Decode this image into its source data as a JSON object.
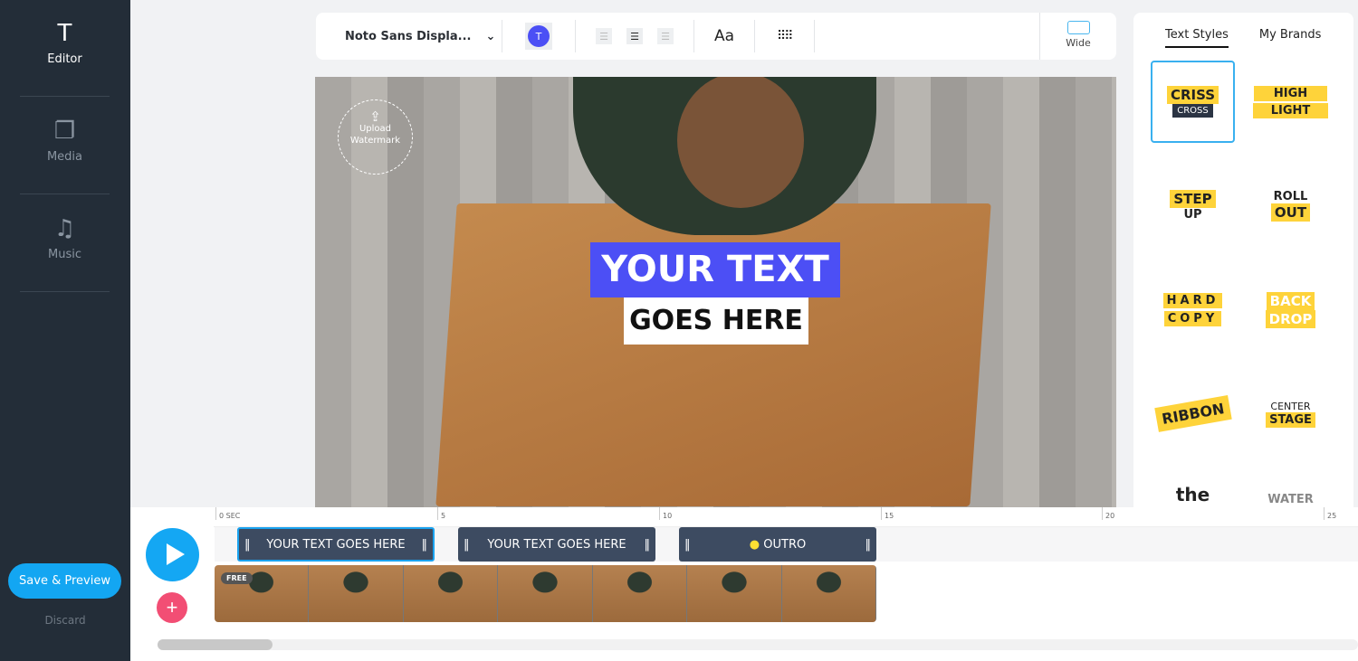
{
  "sidebar": {
    "items": [
      {
        "label": "Editor",
        "icon": "text-icon"
      },
      {
        "label": "Media",
        "icon": "media-icon"
      },
      {
        "label": "Music",
        "icon": "music-icon"
      }
    ],
    "save_label": "Save & Preview",
    "discard_label": "Discard"
  },
  "toolbar": {
    "font": "Noto Sans Displa...",
    "color_label": "T",
    "aa": "Aa",
    "aspect": "Wide",
    "accent": "#4b4ff5"
  },
  "canvas": {
    "watermark_label": "Upload Watermark",
    "text_line1": "YOUR TEXT",
    "text_line2": "GOES HERE"
  },
  "panel": {
    "tabs": [
      "Text Styles",
      "My Brands"
    ],
    "styles": [
      {
        "lines": [
          "CRISS",
          "CROSS"
        ]
      },
      {
        "lines": [
          "HIGH",
          "LIGHT"
        ]
      },
      {
        "lines": [
          "STEP",
          "UP"
        ]
      },
      {
        "lines": [
          "ROLL",
          "OUT"
        ]
      },
      {
        "lines": [
          "HARD",
          "COPY"
        ]
      },
      {
        "lines": [
          "BACK",
          "DROP"
        ]
      },
      {
        "lines": [
          "RIBBON"
        ]
      },
      {
        "lines": [
          "CENTER",
          "STAGE"
        ]
      },
      {
        "lines": [
          "the"
        ]
      },
      {
        "lines": [
          "WATER"
        ]
      }
    ]
  },
  "timeline": {
    "ticks": [
      "0 SEC",
      "5",
      "10",
      "15",
      "20",
      "25"
    ],
    "clips": [
      "YOUR TEXT GOES HERE",
      "YOUR TEXT GOES HERE",
      "OUTRO"
    ],
    "free_badge": "FREE"
  }
}
